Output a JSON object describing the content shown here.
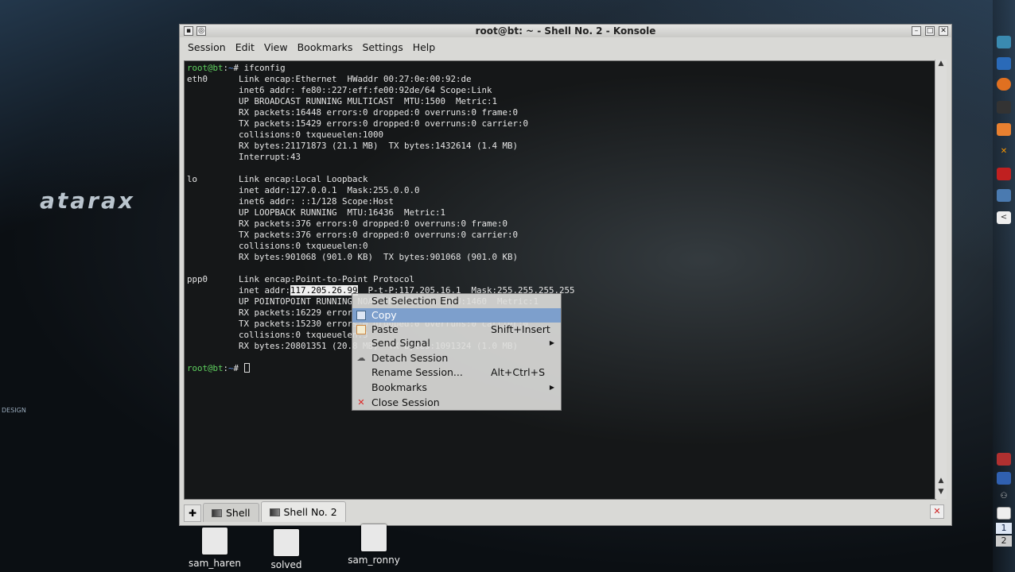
{
  "window": {
    "title": "root@bt: ~ - Shell No. 2 - Konsole"
  },
  "menubar": [
    "Session",
    "Edit",
    "View",
    "Bookmarks",
    "Settings",
    "Help"
  ],
  "prompt": {
    "user": "root@bt",
    "sep": ":",
    "path": "~",
    "sym": "# "
  },
  "command": "ifconfig",
  "output": [
    "eth0      Link encap:Ethernet  HWaddr 00:27:0e:00:92:de",
    "          inet6 addr: fe80::227:eff:fe00:92de/64 Scope:Link",
    "          UP BROADCAST RUNNING MULTICAST  MTU:1500  Metric:1",
    "          RX packets:16448 errors:0 dropped:0 overruns:0 frame:0",
    "          TX packets:15429 errors:0 dropped:0 overruns:0 carrier:0",
    "          collisions:0 txqueuelen:1000",
    "          RX bytes:21171873 (21.1 MB)  TX bytes:1432614 (1.4 MB)",
    "          Interrupt:43",
    "",
    "lo        Link encap:Local Loopback",
    "          inet addr:127.0.0.1  Mask:255.0.0.0",
    "          inet6 addr: ::1/128 Scope:Host",
    "          UP LOOPBACK RUNNING  MTU:16436  Metric:1",
    "          RX packets:376 errors:0 dropped:0 overruns:0 frame:0",
    "          TX packets:376 errors:0 dropped:0 overruns:0 carrier:0",
    "          collisions:0 txqueuelen:0",
    "          RX bytes:901068 (901.0 KB)  TX bytes:901068 (901.0 KB)",
    "",
    "ppp0      Link encap:Point-to-Point Protocol"
  ],
  "ppp0_inet": {
    "pre": "          inet addr:",
    "selected": "117.205.26.99",
    "post": "  P-t-P:117.205.16.1  Mask:255.255.255.255"
  },
  "ppp0_rest": [
    "          UP POINTOPOINT RUNNING NOARP MULTICAST  MTU:1460  Metric:1",
    "          RX packets:16229 errors:0 dropped:0 overruns:0 frame:0",
    "          TX packets:15230 errors:0 dropped:0 overruns:0 carrier:0",
    "          collisions:0 txqueuelen:3",
    "          RX bytes:20801351 (20.8 MB)  TX bytes:1091324 (1.0 MB)"
  ],
  "tabs": [
    {
      "label": "Shell"
    },
    {
      "label": "Shell No. 2",
      "active": true
    }
  ],
  "context_menu": [
    {
      "label": "Set Selection End",
      "shortcut": ""
    },
    {
      "label": "Copy",
      "shortcut": "",
      "highlighted": true,
      "icon": "copy-icon"
    },
    {
      "label": "Paste",
      "shortcut": "Shift+Insert",
      "icon": "paste-icon"
    },
    {
      "label": "Send Signal",
      "submenu": true
    },
    {
      "label": "Detach Session",
      "icon": "detach-icon"
    },
    {
      "label": "Rename Session...",
      "shortcut": "Alt+Ctrl+S"
    },
    {
      "label": "Bookmarks",
      "submenu": true
    },
    {
      "label": "Close Session",
      "icon": "close-icon"
    }
  ],
  "desktop_icons": [
    "sam_haren",
    "solved",
    "sam_ronny"
  ],
  "wallpaper_text": {
    "logo": "atarax",
    "credit": "DESIGN"
  },
  "pager": [
    "1",
    "2"
  ],
  "colors": {
    "menu_highlight": "#7d9fcc",
    "prompt_user": "#5fd15f",
    "prompt_path": "#5a8ad8"
  }
}
